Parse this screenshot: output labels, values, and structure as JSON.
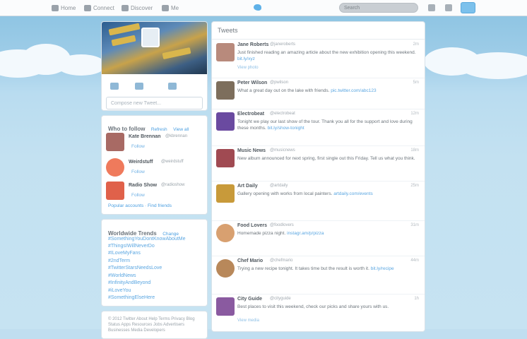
{
  "topbar": {
    "nav": [
      {
        "label": "Home",
        "icon": "home-icon"
      },
      {
        "label": "Connect",
        "icon": "at-icon"
      },
      {
        "label": "Discover",
        "icon": "hash-icon"
      },
      {
        "label": "Me",
        "icon": "user-icon"
      }
    ],
    "search_placeholder": "Search"
  },
  "profile": {
    "compose_placeholder": "Compose new Tweet..."
  },
  "who_to_follow": {
    "title": "Who to follow",
    "refresh": "Refresh",
    "view_all": "View all",
    "people": [
      {
        "name": "Kate Brennan",
        "handle": "@kbrennan",
        "follow": "Follow",
        "color": "#a86a64"
      },
      {
        "name": "Weirdstuff",
        "handle": "@weirdstuff",
        "follow": "Follow",
        "color": "#ef7a5c"
      },
      {
        "name": "Radio Show",
        "handle": "@radioshow",
        "follow": "Follow",
        "color": "#e0614a"
      }
    ],
    "footer": "Popular accounts · Find friends"
  },
  "trends": {
    "title": "Worldwide Trends",
    "change": "Change",
    "items": [
      "#SomethingYouDontKnowAboutMe",
      "#ThingsIWillNeverDo",
      "#ILoveMyFans",
      "#2ndTerm",
      "#TwitterStarsNeedsLove",
      "#WorldNews",
      "#InfinityAndBeyond",
      "#iLoveYou",
      "#SomethingElseHere"
    ]
  },
  "bottom_card_text": "© 2012 Twitter About Help Terms Privacy Blog Status Apps Resources Jobs Advertisers Businesses Media Developers",
  "timeline": {
    "title": "Tweets",
    "tweets": [
      {
        "name": "Jane Roberts",
        "meta": "@janeroberts",
        "time": "2m",
        "text": "Just finished reading an amazing article about the new exhibition opening this weekend.",
        "link": "bit.ly/xyz",
        "foot": "View photo",
        "color": "#b88a7c"
      },
      {
        "name": "Peter Wilson",
        "meta": "@pwilson",
        "time": "5m",
        "text": "What a great day out on the lake with friends.",
        "link": "pic.twitter.com/abc123",
        "foot": "",
        "color": "#7d6e5c"
      },
      {
        "name": "Electrobeat",
        "meta": "@electrobeat",
        "time": "12m",
        "text": "Tonight we play our last show of the tour. Thank you all for the support and love during these months.",
        "link": "bit.ly/show-tonight",
        "foot": "",
        "color": "#6a4aa0"
      },
      {
        "name": "Music News",
        "meta": "@musicnews",
        "time": "18m",
        "text": "New album announced for next spring, first single out this Friday. Tell us what you think.",
        "link": "",
        "foot": "",
        "color": "#a04a52"
      },
      {
        "name": "Art Daily",
        "meta": "@artdaily",
        "time": "25m",
        "text": "Gallery opening with works from local painters.",
        "link": "artdaily.com/events",
        "foot": "",
        "color": "#c89a3a"
      },
      {
        "name": "Food Lovers",
        "meta": "@foodlovers",
        "time": "31m",
        "text": "Homemade pizza night.",
        "link": "instagr.am/p/pizza",
        "foot": "",
        "color": "#d8a070"
      },
      {
        "name": "Chef Mario",
        "meta": "@chefmario",
        "time": "44m",
        "text": "Trying a new recipe tonight. It takes time but the result is worth it.",
        "link": "bit.ly/recipe",
        "foot": "",
        "color": "#b8885a"
      },
      {
        "name": "City Guide",
        "meta": "@cityguide",
        "time": "1h",
        "text": "Best places to visit this weekend, check our picks and share yours with us.",
        "link": "",
        "foot": "View media",
        "color": "#8a5aa0"
      }
    ]
  }
}
